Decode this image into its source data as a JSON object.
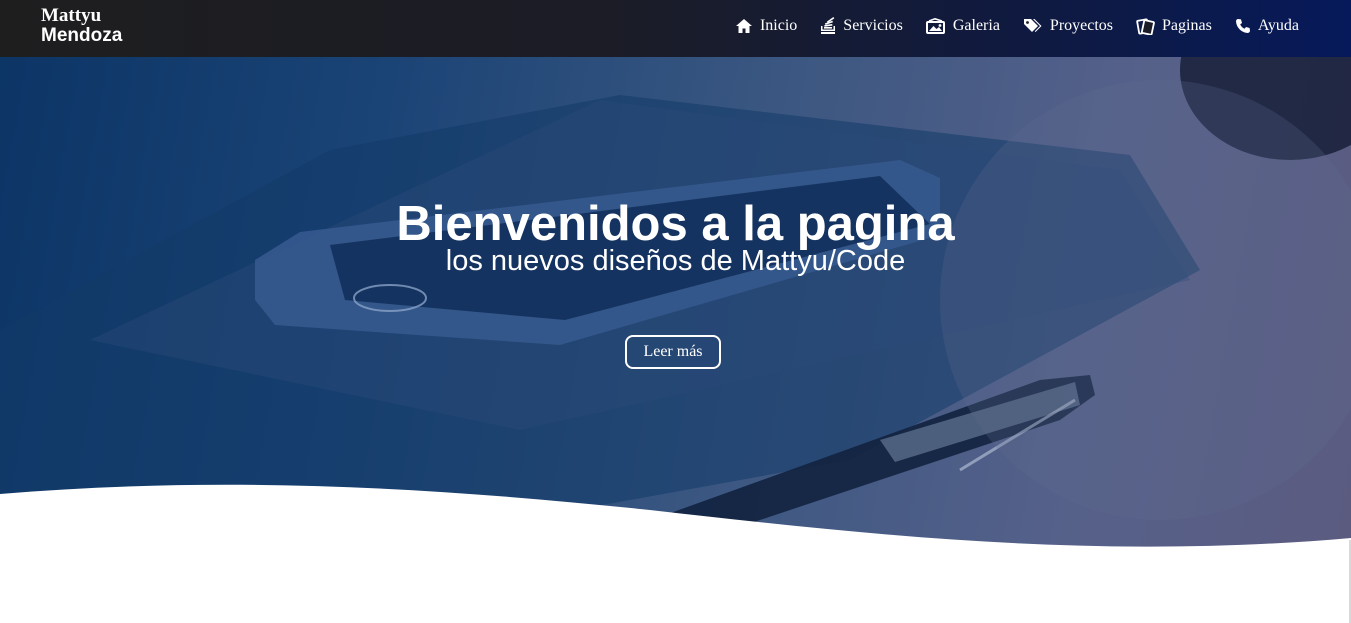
{
  "colors": {
    "topbar_start": "#1e1e1f",
    "topbar_end": "#06195a",
    "hero_start": "#0c3566",
    "hero_end": "#5b5b80",
    "text": "#ffffff",
    "page_background": "#ffffff"
  },
  "header": {
    "brand": {
      "line1": "Mattyu",
      "line2": "Mendoza"
    },
    "nav": [
      {
        "label": "Inicio",
        "icon": "home-icon"
      },
      {
        "label": "Servicios",
        "icon": "stack-icon"
      },
      {
        "label": "Galeria",
        "icon": "gallery-icon"
      },
      {
        "label": "Proyectos",
        "icon": "tags-icon"
      },
      {
        "label": "Paginas",
        "icon": "pages-icon"
      },
      {
        "label": "Ayuda",
        "icon": "phone-icon"
      }
    ]
  },
  "hero": {
    "title": "Bienvenidos a la pagina",
    "subtitle": "los nuevos diseños de Mattyu/Code",
    "button_label": "Leer más",
    "background_image": "smartphone-and-pen-on-notebook"
  }
}
